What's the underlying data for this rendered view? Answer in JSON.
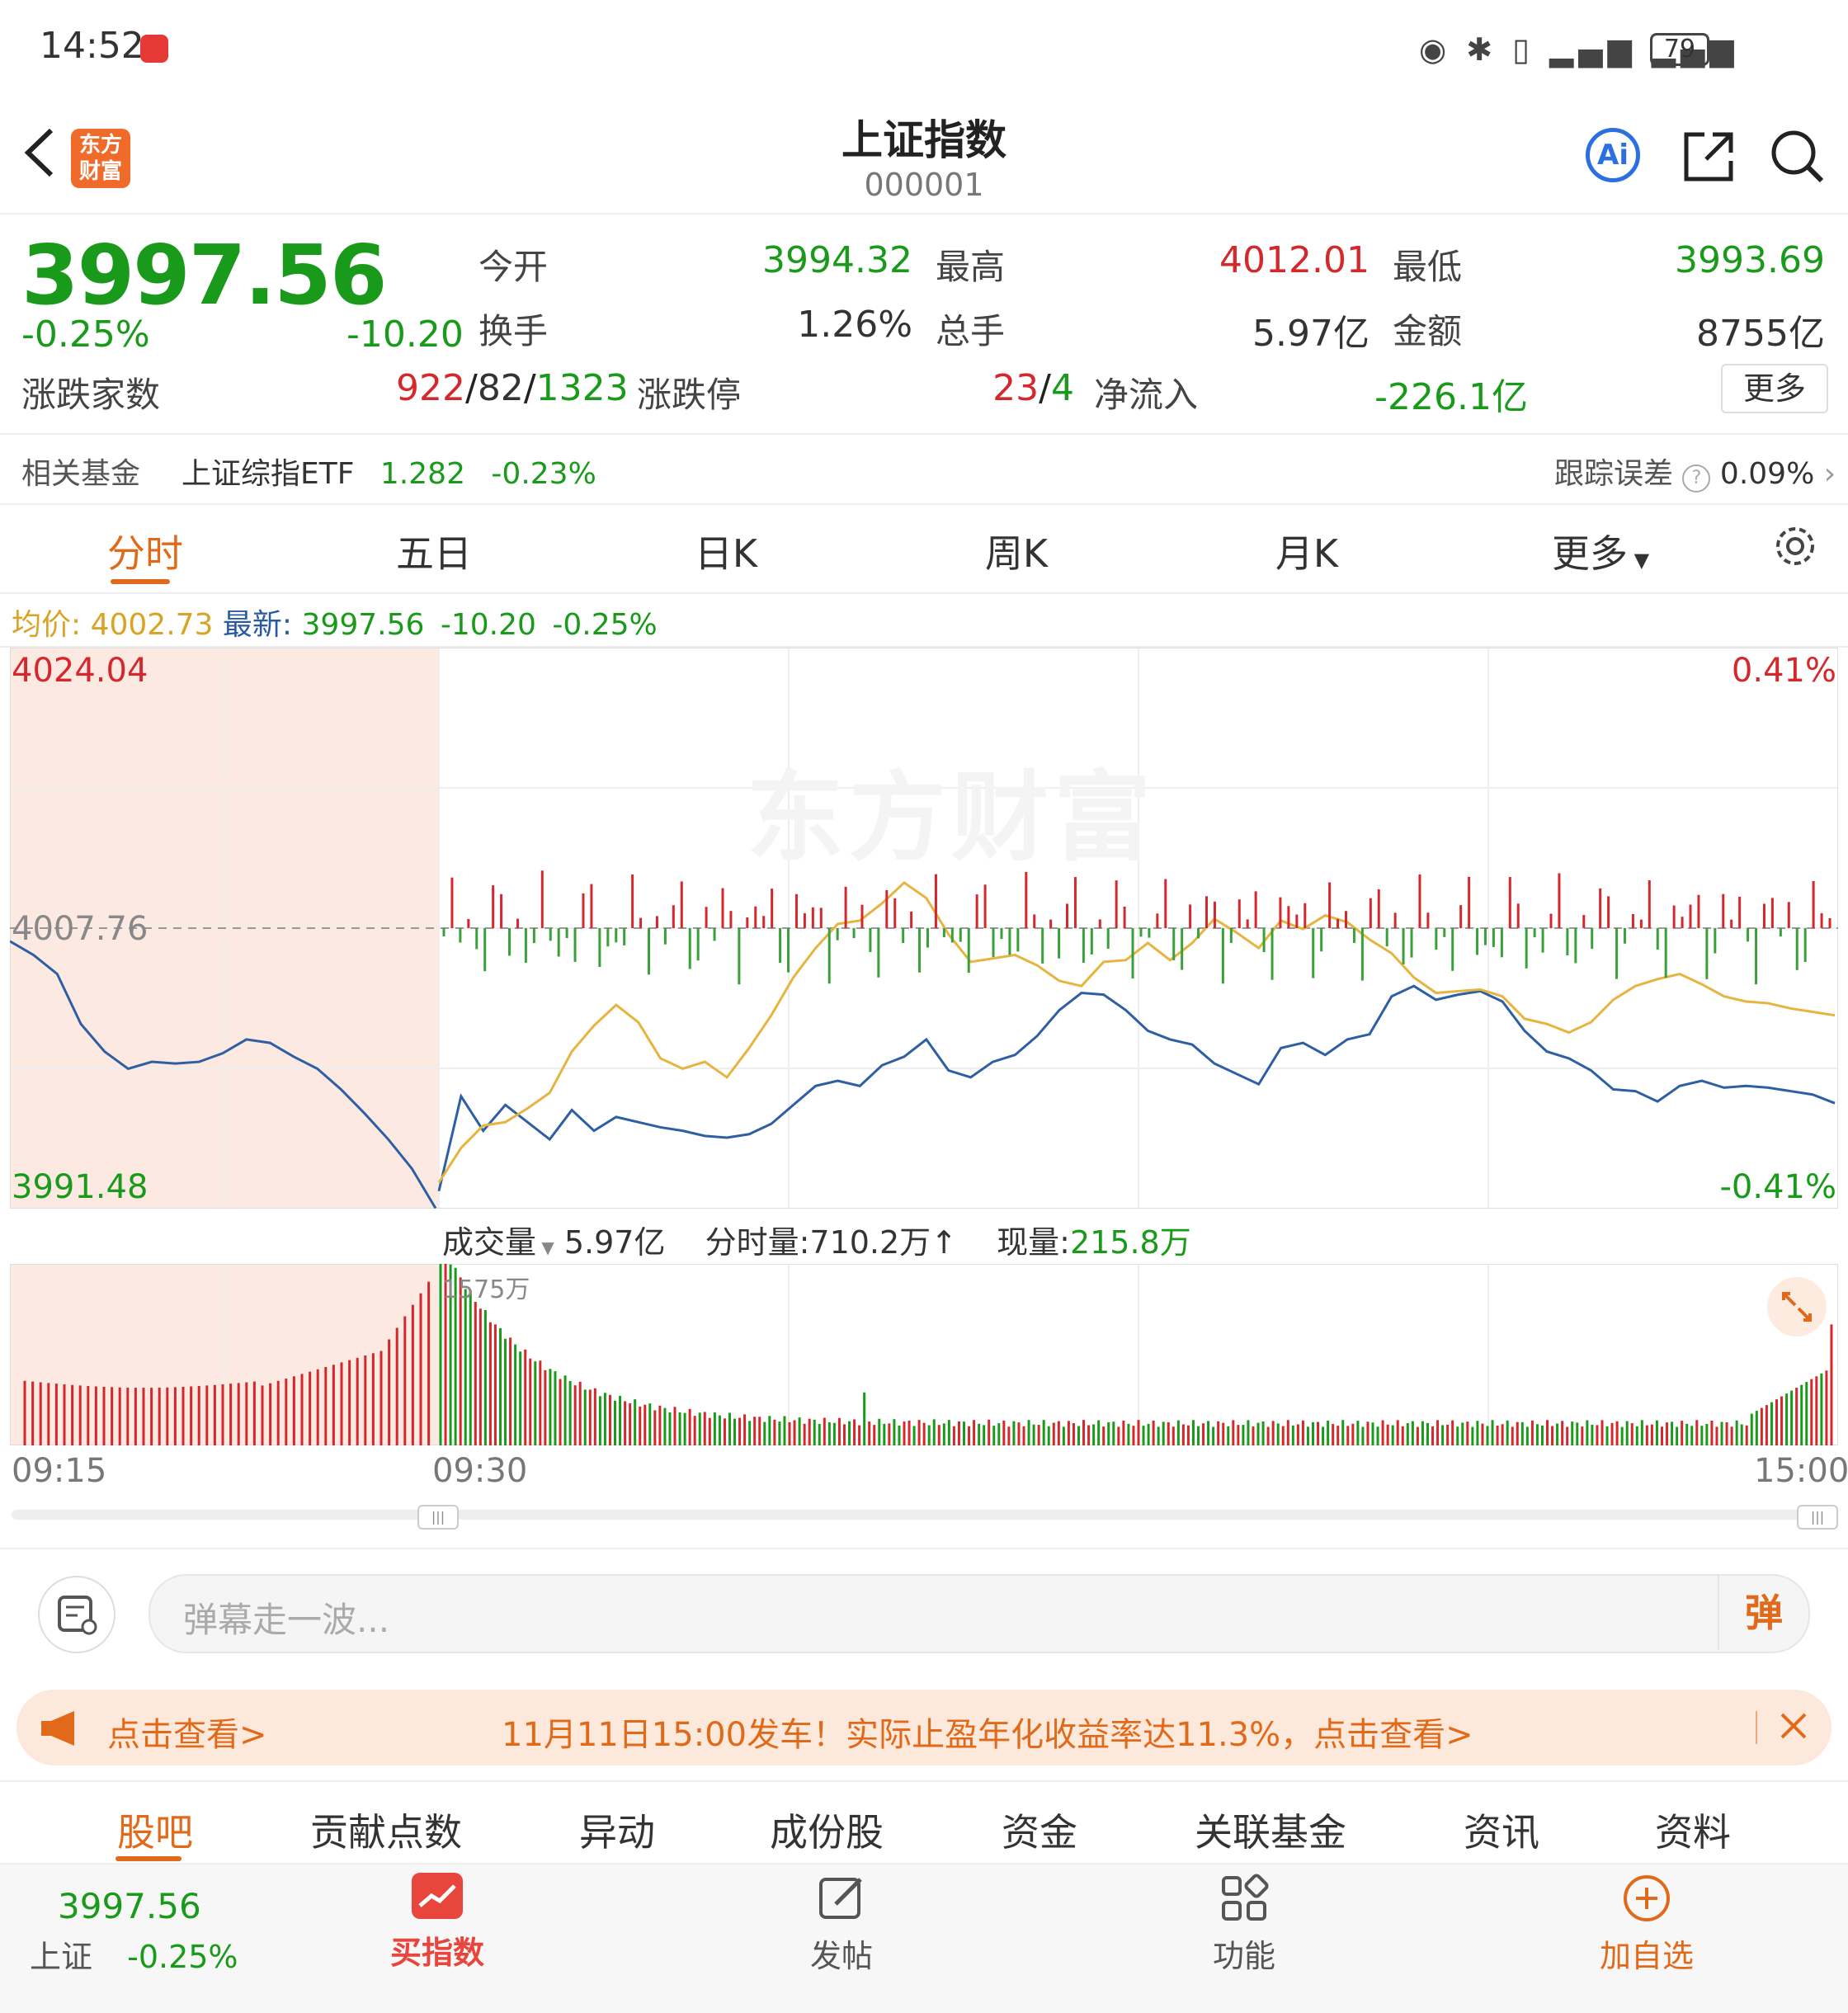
{
  "status": {
    "time": "14:52",
    "battery": "79"
  },
  "header": {
    "title": "上证指数",
    "code": "000001",
    "logo": "东方财富",
    "ai_label": "Ai"
  },
  "quote": {
    "price": "3997.56",
    "change_pct": "-0.25%",
    "change": "-10.20",
    "open_label": "今开",
    "open": "3994.32",
    "high_label": "最高",
    "high": "4012.01",
    "low_label": "最低",
    "low": "3993.69",
    "turnover_label": "换手",
    "turnover": "1.26%",
    "volume_label": "总手",
    "volume": "5.97亿",
    "amount_label": "金额",
    "amount": "8755亿",
    "breadth_label": "涨跌家数",
    "breadth_up": "922",
    "breadth_flat": "82",
    "breadth_down": "1323",
    "limit_label": "涨跌停",
    "limit_up": "23",
    "limit_down": "4",
    "netflow_label": "净流入",
    "netflow": "-226.1亿",
    "more": "更多"
  },
  "fund": {
    "label": "相关基金",
    "name": "上证综指ETF",
    "price": "1.282",
    "pct": "-0.23%",
    "track_label": "跟踪误差",
    "track": "0.09%"
  },
  "tabs": [
    "分时",
    "五日",
    "日K",
    "周K",
    "月K",
    "更多"
  ],
  "legend": {
    "avg_label": "均价:",
    "avg": "4002.73",
    "latest_label": "最新:",
    "latest": "3997.56",
    "chg": "-10.20",
    "pct": "-0.25%"
  },
  "axis": {
    "top": "4024.04",
    "mid": "4007.76",
    "bottom": "3991.48",
    "top_pct": "0.41%",
    "bottom_pct": "-0.41%",
    "t0": "09:15",
    "t1": "09:30",
    "t2": "15:00"
  },
  "volume_info": {
    "label": "成交量",
    "total": "5.97亿",
    "minute_label": "分时量:",
    "minute": "710.2万",
    "arrow": "↑",
    "current_label": "现量:",
    "current": "215.8万",
    "max": "1575万"
  },
  "watermark": "东方财富",
  "comment": {
    "placeholder": "弹幕走一波...",
    "btn": "弹"
  },
  "banner": {
    "left": "点击查看>",
    "text": "11月11日15:00发车！实际止盈年化收益率达11.3%，点击查看>"
  },
  "bottom_tabs": [
    "股吧",
    "贡献点数",
    "异动",
    "成份股",
    "资金",
    "关联基金",
    "资讯",
    "资料"
  ],
  "nav": {
    "mini_price": "3997.56",
    "mini_name": "上证",
    "mini_pct": "-0.25%",
    "buy": "买指数",
    "post": "发帖",
    "func": "功能",
    "add": "加自选"
  },
  "chart_data": {
    "type": "line",
    "title": "",
    "ylim": [
      3991.48,
      4024.04
    ],
    "prev_close": 4007.76,
    "x_ticks": [
      "09:15",
      "09:30",
      "15:00"
    ],
    "pre_market": [
      4007.0,
      4006.2,
      4005.1,
      4002.2,
      4000.6,
      3999.6,
      4000.0,
      3999.9,
      4000.0,
      4000.5,
      4001.3,
      4001.1,
      4000.3,
      3999.6,
      3998.4,
      3997.0,
      3995.5,
      3993.8,
      3991.5
    ],
    "series": [
      {
        "name": "最新",
        "color": "#2e5fa3",
        "values": [
          3992.5,
          3998,
          3996,
          3997.5,
          3996.5,
          3995.5,
          3997.2,
          3996,
          3996.8,
          3996.5,
          3996.2,
          3996,
          3995.7,
          3995.6,
          3995.8,
          3996.4,
          3997.5,
          3998.6,
          3998.9,
          3998.6,
          3999.8,
          4000.3,
          4001.3,
          3999.5,
          3999.1,
          4000,
          4000.4,
          4001.5,
          4003,
          4004,
          4003.9,
          4003,
          4001.8,
          4001.3,
          4001,
          3999.9,
          3999.3,
          3998.7,
          4000.8,
          4001.1,
          4000.4,
          4001.3,
          4001.6,
          4003.8,
          4004.4,
          4003.6,
          4003.9,
          4004.1,
          4003.5,
          4001.8,
          4000.6,
          4000.2,
          3999.5,
          3998.4,
          3998.3,
          3997.7,
          3998.6,
          3998.9,
          3998.5,
          3998.6,
          3998.5,
          3998.3,
          3998.1,
          3997.6
        ]
      },
      {
        "name": "均价",
        "color": "#e6b440",
        "values": [
          3993,
          3995,
          3996.3,
          3996.5,
          3997.3,
          3998.2,
          4000.6,
          4002.1,
          4003.3,
          4002.3,
          4000.2,
          3999.6,
          4000,
          3999.1,
          4000.8,
          4002.7,
          4004.9,
          4006.6,
          4008,
          4008.2,
          4009.2,
          4010.4,
          4009.5,
          4007.4,
          4005.8,
          4006,
          4006.2,
          4005.6,
          4004.7,
          4004.4,
          4005.8,
          4005.9,
          4006.9,
          4005.9,
          4006.9,
          4008.3,
          4007.5,
          4006.6,
          4008.2,
          4007.7,
          4008.5,
          4008.1,
          4007.1,
          4006.3,
          4004.9,
          4004,
          4004.1,
          4004.2,
          4003.8,
          4002.5,
          4002.2,
          4001.7,
          4002.3,
          4003.6,
          4004.4,
          4004.8,
          4005.1,
          4004.5,
          4003.8,
          4003.5,
          4003.4,
          4003.1,
          4002.9,
          4002.7
        ]
      }
    ],
    "volume": {
      "unit": "万",
      "max": 1575
    }
  }
}
